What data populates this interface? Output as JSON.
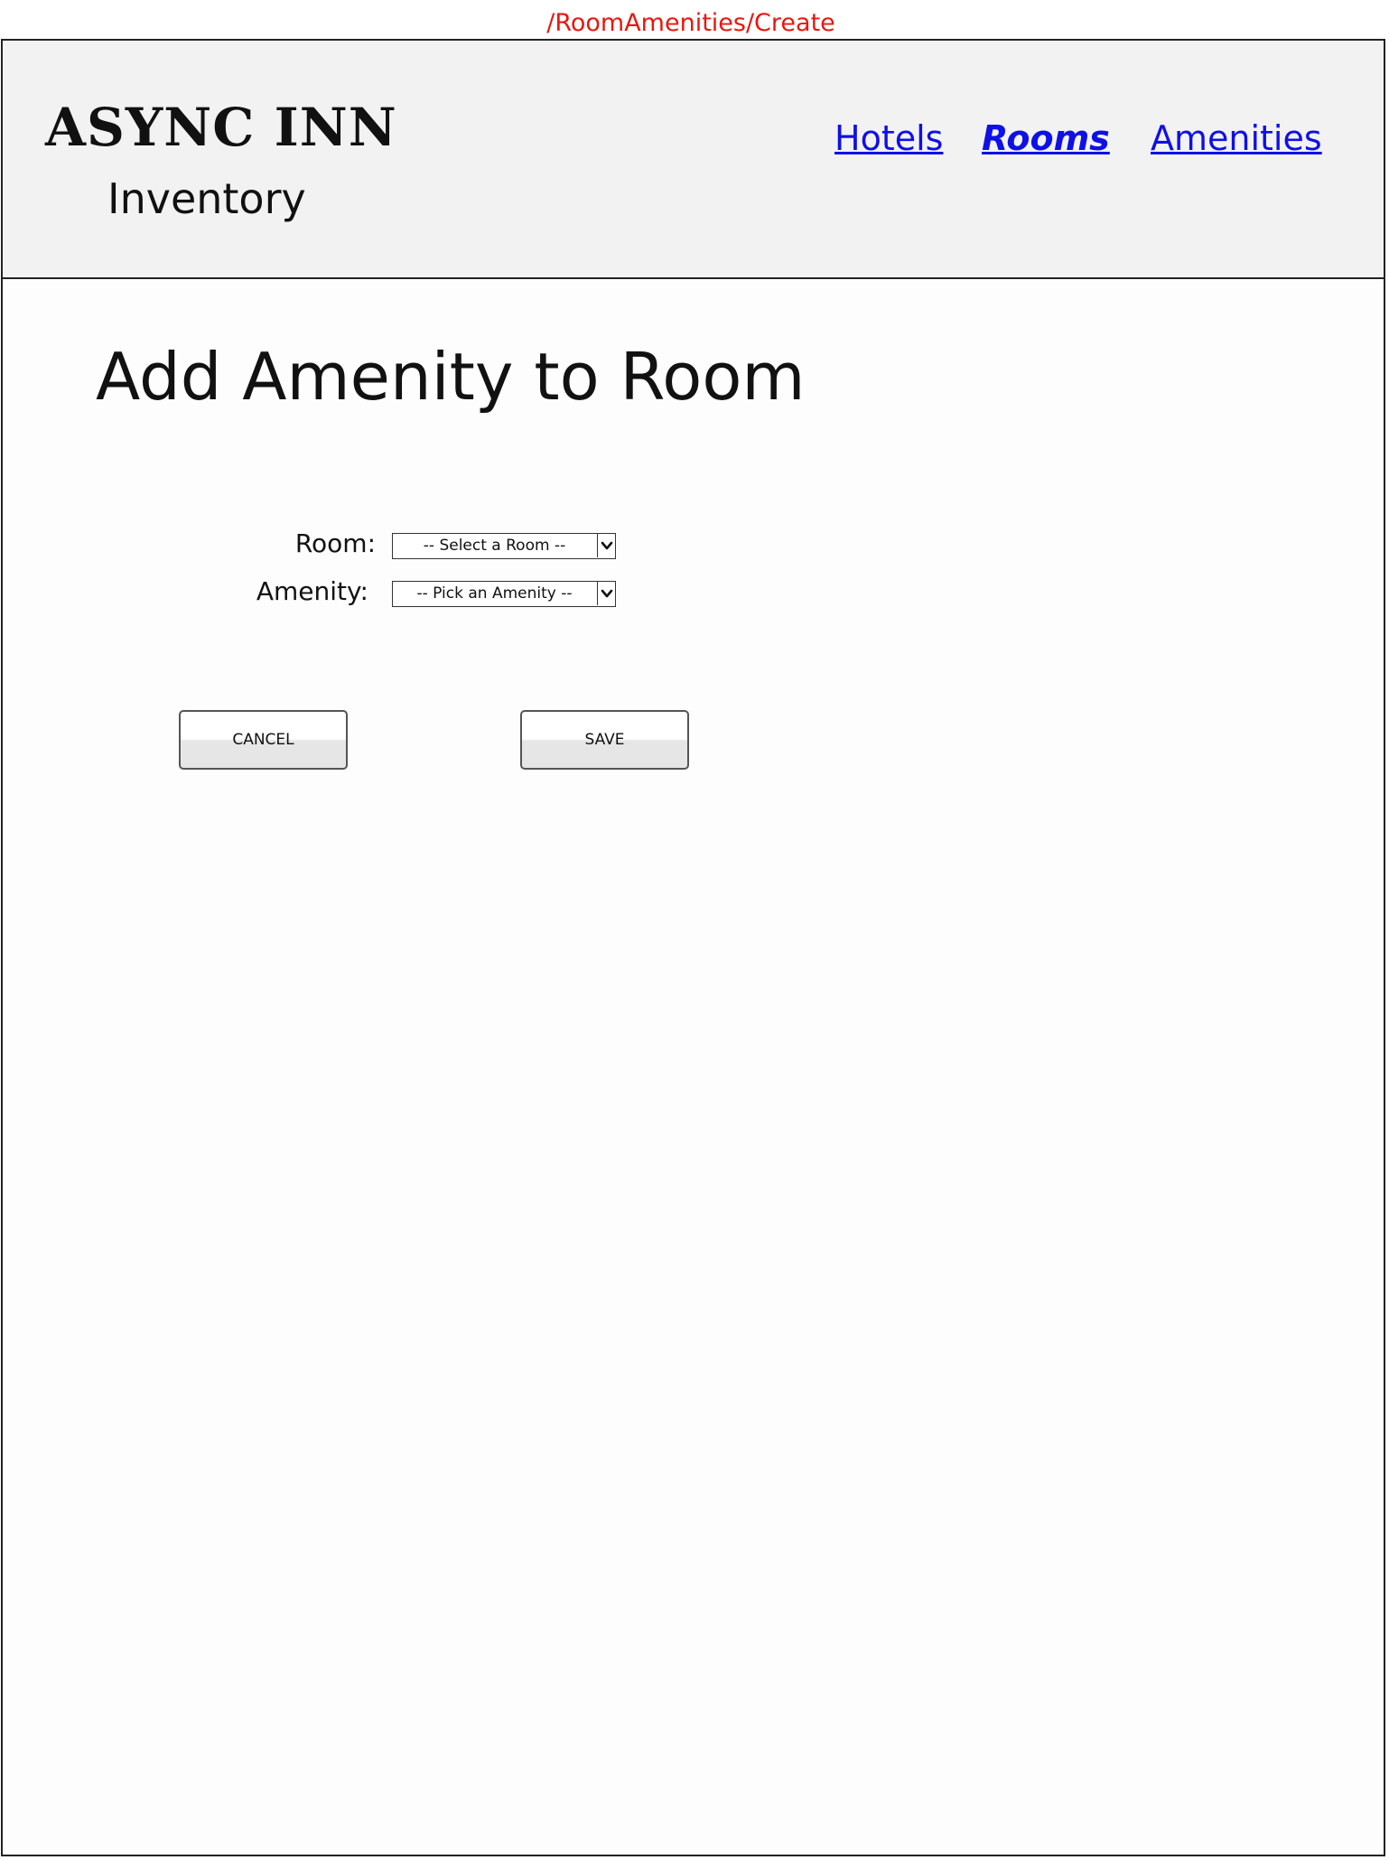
{
  "route": "/RoomAmenities/Create",
  "header": {
    "brand_title": "ASYNC INN",
    "brand_subtitle": "Inventory",
    "nav": [
      {
        "label": "Hotels",
        "active": false
      },
      {
        "label": "Rooms",
        "active": true
      },
      {
        "label": "Amenities",
        "active": false
      }
    ]
  },
  "main": {
    "title": "Add Amenity to Room",
    "form": {
      "room_label": "Room:",
      "room_select_value": "-- Select a Room --",
      "amenity_label": "Amenity:",
      "amenity_select_value": "-- Pick an Amenity --"
    },
    "buttons": {
      "cancel_label": "CANCEL",
      "save_label": "SAVE"
    }
  },
  "icons": {
    "select_arrow": "chevron-down-icon"
  },
  "colors": {
    "route_label": "#e8170f",
    "link": "#0f10e6",
    "header_background": "#f2f2f2"
  }
}
